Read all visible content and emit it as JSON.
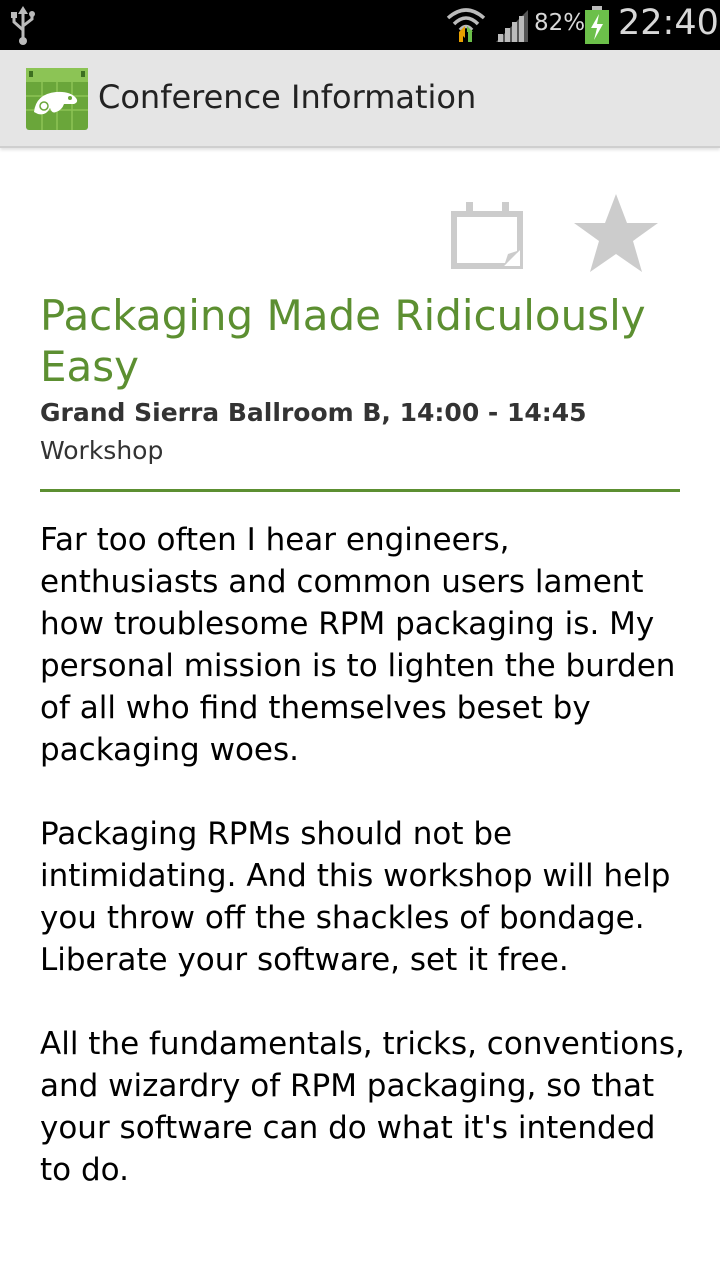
{
  "status_bar": {
    "battery_percent": "82%",
    "time": "22:40",
    "icons": [
      "usb-icon",
      "wifi-icon",
      "signal-icon",
      "battery-charging-icon"
    ]
  },
  "action_bar": {
    "title": "Conference Information",
    "app_icon": "opensuse-chameleon-calendar-icon",
    "accent_color": "#6aa63a"
  },
  "session": {
    "actions": [
      "calendar-icon",
      "star-icon"
    ],
    "title": "Packaging Made Ridiculously Easy",
    "location_time": "Grand Sierra Ballroom B, 14:00 - 14:45",
    "type": "Workshop",
    "title_color": "#5c8f31",
    "abstract": [
      "Far too often I hear engineers, enthusiasts and common users lament how troublesome RPM packaging is. My personal mission is to lighten the burden of all who find themselves beset by packaging woes.",
      "Packaging RPMs should not be intimidating. And this workshop will help you throw off the shackles of bondage. Liberate your software, set it free.",
      "All the fundamentals, tricks, conventions, and wizardry of RPM packaging, so that your software can do what it's intended to do."
    ]
  }
}
